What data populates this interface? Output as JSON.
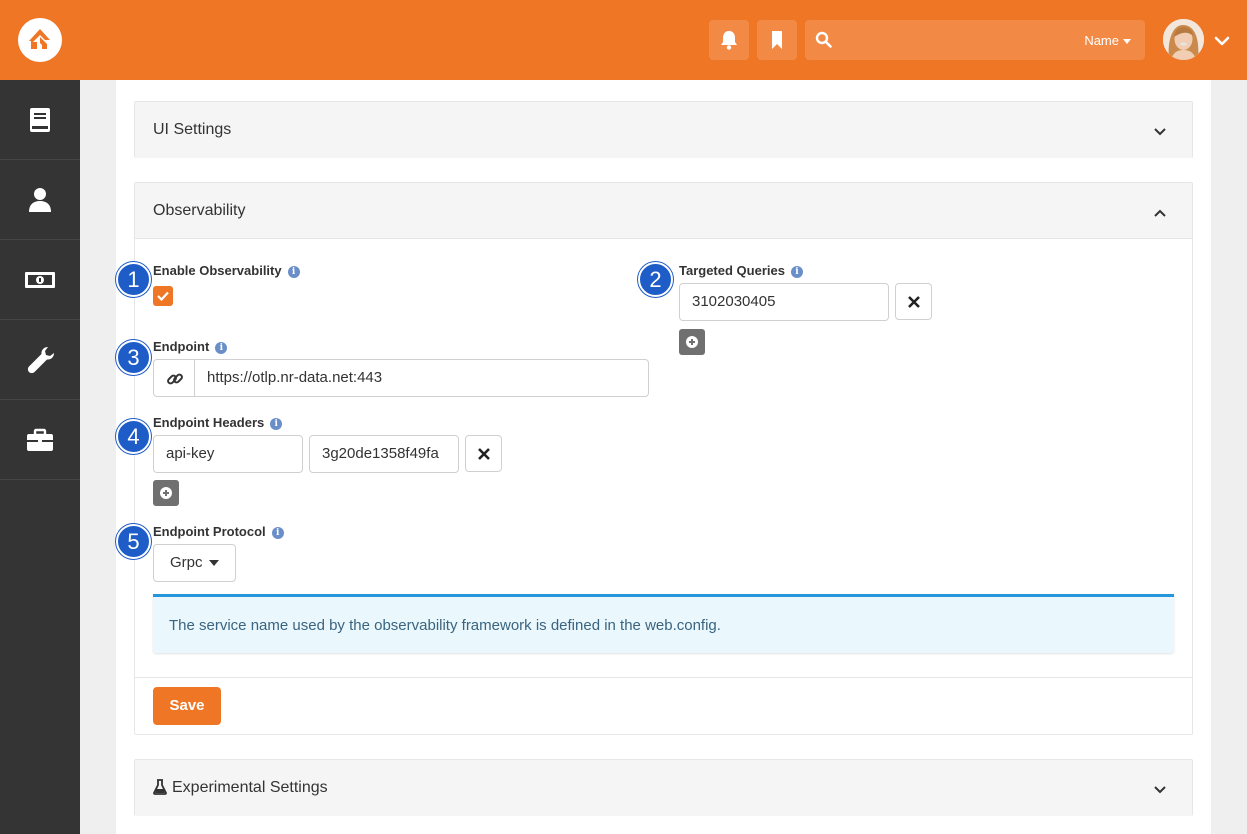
{
  "header": {
    "search": {
      "scope_label": "Name"
    }
  },
  "sidebar": {
    "items": [
      {
        "icon": "book-icon"
      },
      {
        "icon": "person-icon"
      },
      {
        "icon": "money-icon"
      },
      {
        "icon": "wrench-icon"
      },
      {
        "icon": "briefcase-icon"
      }
    ]
  },
  "panels": {
    "ui_settings": {
      "title": "UI Settings"
    },
    "observability": {
      "title": "Observability"
    },
    "experimental": {
      "title": "Experimental Settings"
    }
  },
  "observability": {
    "badges": [
      "1",
      "2",
      "3",
      "4",
      "5"
    ],
    "enable": {
      "label": "Enable Observability",
      "checked": true
    },
    "targeted_queries": {
      "label": "Targeted Queries",
      "values": [
        "3102030405"
      ]
    },
    "endpoint": {
      "label": "Endpoint",
      "value": "https://otlp.nr-data.net:443"
    },
    "endpoint_headers": {
      "label": "Endpoint Headers",
      "key": "api-key",
      "value": "3g20de1358f49fa"
    },
    "endpoint_protocol": {
      "label": "Endpoint Protocol",
      "value": "Grpc"
    },
    "alert": "The service name used by the observability framework is defined in the web.config.",
    "save_label": "Save"
  },
  "colors": {
    "brand": "#ee7625",
    "badge": "#1e5cc8",
    "sidebar": "#343434",
    "alert_border": "#2596d9"
  }
}
